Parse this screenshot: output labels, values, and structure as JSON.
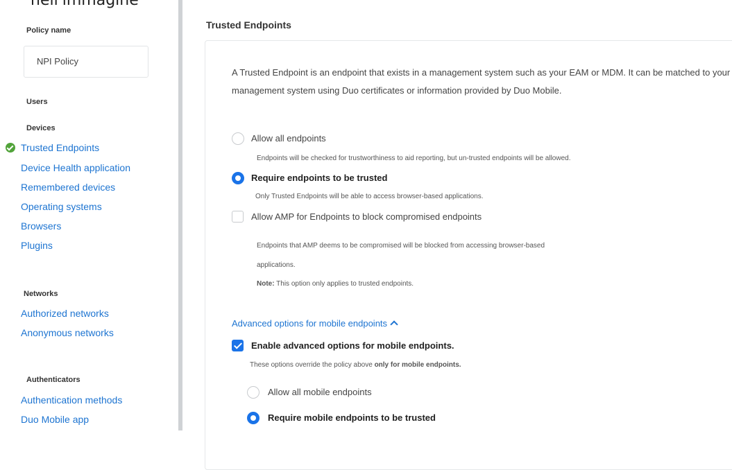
{
  "caption": "nell'immagine",
  "sidebar": {
    "policy_name_label": "Policy name",
    "policy_name_value": "NPI Policy",
    "users_label": "Users",
    "devices_label": "Devices",
    "devices_items": [
      "Trusted Endpoints",
      "Device Health application",
      "Remembered devices",
      "Operating systems",
      "Browsers",
      "Plugins"
    ],
    "networks_label": "Networks",
    "networks_items": [
      "Authorized networks",
      "Anonymous networks"
    ],
    "authenticators_label": "Authenticators",
    "authenticators_items": [
      "Authentication methods",
      "Duo Mobile app"
    ]
  },
  "main": {
    "title": "Trusted Endpoints",
    "description": "A Trusted Endpoint is an endpoint that exists in a management system such as your EAM or MDM. It can be matched to your management system using Duo certificates or information provided by Duo Mobile.",
    "allow_all_label": "Allow all endpoints",
    "allow_all_help": "Endpoints will be checked for trustworthiness to aid reporting, but un-trusted endpoints will be allowed.",
    "require_label": "Require endpoints to be trusted",
    "require_help": "Only Trusted Endpoints will be able to access browser-based applications.",
    "amp_label": "Allow AMP for Endpoints to block compromised endpoints",
    "amp_help_line1": "Endpoints that AMP deems to be compromised will be blocked from accessing browser-based",
    "amp_help_line2": "applications.",
    "amp_note_label": "Note:",
    "amp_note_text": " This option only applies to trusted endpoints.",
    "advanced_link": "Advanced options for mobile endpoints",
    "enable_advanced_label": "Enable advanced options for mobile endpoints.",
    "override_text_1": "These options override the policy above ",
    "override_text_bold": "only for mobile endpoints.",
    "mobile_allow_label": "Allow all mobile endpoints",
    "mobile_require_label": "Require mobile endpoints to be trusted"
  },
  "state": {
    "endpoints_mode": "require",
    "amp_checked": false,
    "advanced_checked": true,
    "mobile_mode": "require"
  },
  "colors": {
    "link": "#1d74d1",
    "accent": "#1a73e8",
    "success": "#51a33a"
  }
}
